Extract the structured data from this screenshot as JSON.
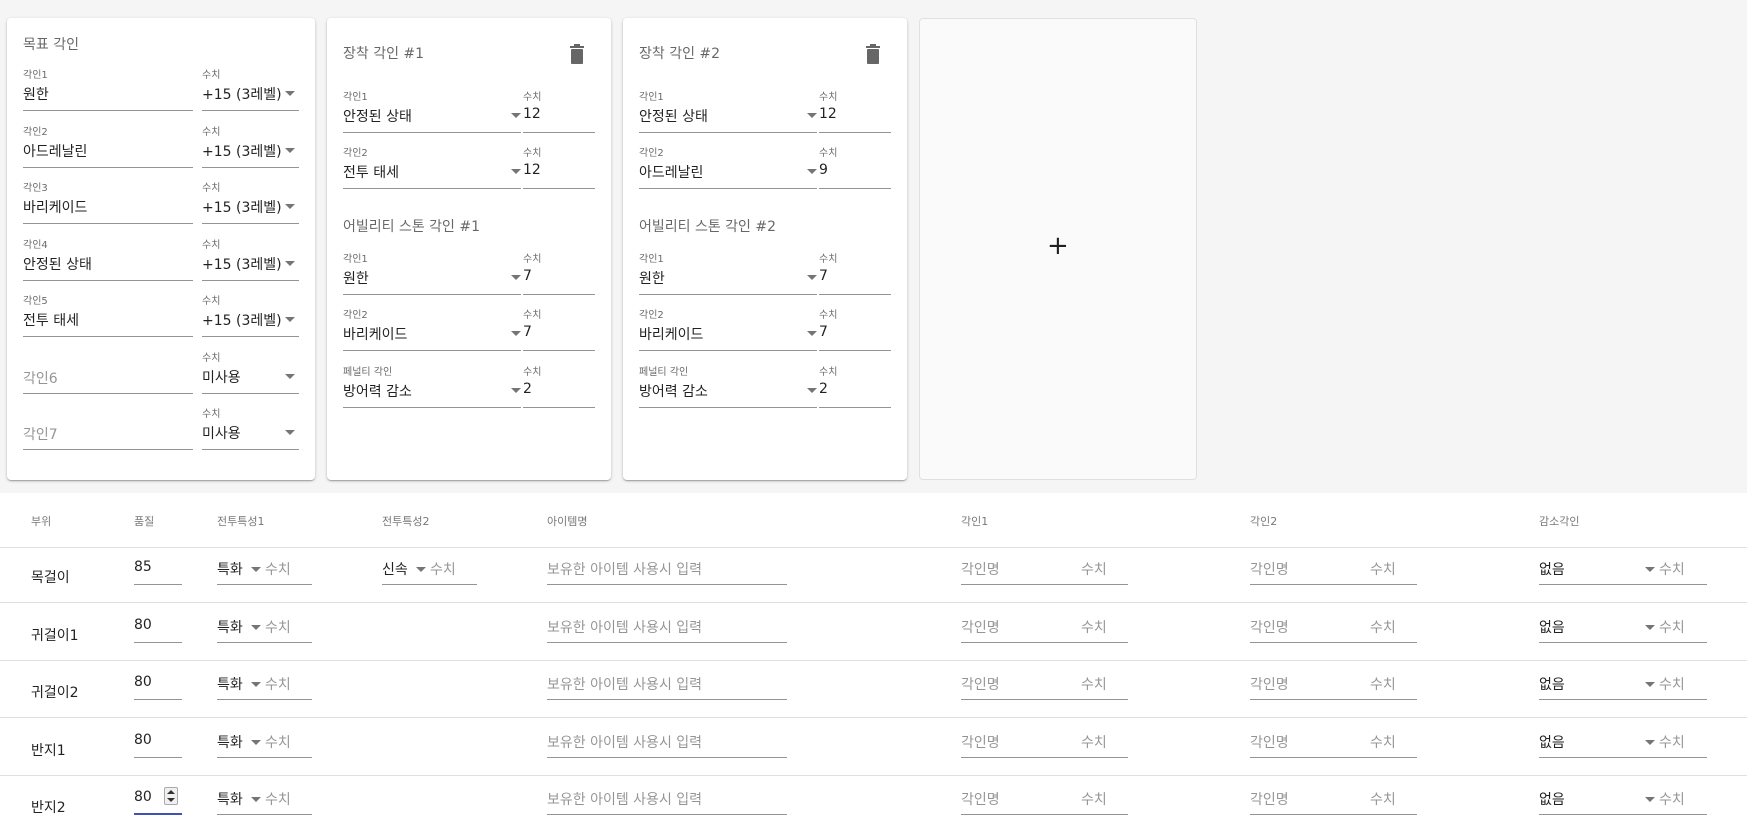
{
  "target": {
    "title": "목표 각인",
    "rows": [
      {
        "label": "각인1",
        "name": "원한",
        "value_label": "수치",
        "value": "+15 (3레벨)"
      },
      {
        "label": "각인2",
        "name": "아드레날린",
        "value_label": "수치",
        "value": "+15 (3레벨)"
      },
      {
        "label": "각인3",
        "name": "바리케이드",
        "value_label": "수치",
        "value": "+15 (3레벨)"
      },
      {
        "label": "각인4",
        "name": "안정된 상태",
        "value_label": "수치",
        "value": "+15 (3레벨)"
      },
      {
        "label": "각인5",
        "name": "전투 태세",
        "value_label": "수치",
        "value": "+15 (3레벨)"
      },
      {
        "placeholder": "각인6",
        "value_label": "수치",
        "value": "미사용"
      },
      {
        "placeholder": "각인7",
        "value_label": "수치",
        "value": "미사용"
      }
    ]
  },
  "books": [
    {
      "title": "장착 각인 #1",
      "equip": [
        {
          "label": "각인1",
          "name": "안정된 상태",
          "value_label": "수치",
          "value": "12"
        },
        {
          "label": "각인2",
          "name": "전투 태세",
          "value_label": "수치",
          "value": "12"
        }
      ],
      "stone_title": "어빌리티 스톤 각인 #1",
      "stone": [
        {
          "label": "각인1",
          "name": "원한",
          "value_label": "수치",
          "value": "7"
        },
        {
          "label": "각인2",
          "name": "바리케이드",
          "value_label": "수치",
          "value": "7"
        },
        {
          "label": "페널티 각인",
          "name": "방어력 감소",
          "value_label": "수치",
          "value": "2"
        }
      ]
    },
    {
      "title": "장착 각인 #2",
      "equip": [
        {
          "label": "각인1",
          "name": "안정된 상태",
          "value_label": "수치",
          "value": "12"
        },
        {
          "label": "각인2",
          "name": "아드레날린",
          "value_label": "수치",
          "value": "9"
        }
      ],
      "stone_title": "어빌리티 스톤 각인 #2",
      "stone": [
        {
          "label": "각인1",
          "name": "원한",
          "value_label": "수치",
          "value": "7"
        },
        {
          "label": "각인2",
          "name": "바리케이드",
          "value_label": "수치",
          "value": "7"
        },
        {
          "label": "페널티 각인",
          "name": "방어력 감소",
          "value_label": "수치",
          "value": "2"
        }
      ]
    }
  ],
  "add_card": {
    "symbol": "+"
  },
  "table": {
    "headers": [
      "부위",
      "품질",
      "전투특성1",
      "전투특성2",
      "아이템명",
      "각인1",
      "각인2",
      "감소각인"
    ],
    "placeholders": {
      "stat_value": "수치",
      "item_name": "보유한 아이템 사용시 입력",
      "engrave_name": "각인명",
      "engrave_value": "수치"
    },
    "rows": [
      {
        "part": "목걸이",
        "quality": "85",
        "stat1": "특화",
        "stat2": "신속",
        "penalty": "없음"
      },
      {
        "part": "귀걸이1",
        "quality": "80",
        "stat1": "특화",
        "penalty": "없음"
      },
      {
        "part": "귀걸이2",
        "quality": "80",
        "stat1": "특화",
        "penalty": "없음"
      },
      {
        "part": "반지1",
        "quality": "80",
        "stat1": "특화",
        "penalty": "없음"
      },
      {
        "part": "반지2",
        "quality": "80",
        "stat1": "특화",
        "penalty": "없음"
      }
    ]
  }
}
